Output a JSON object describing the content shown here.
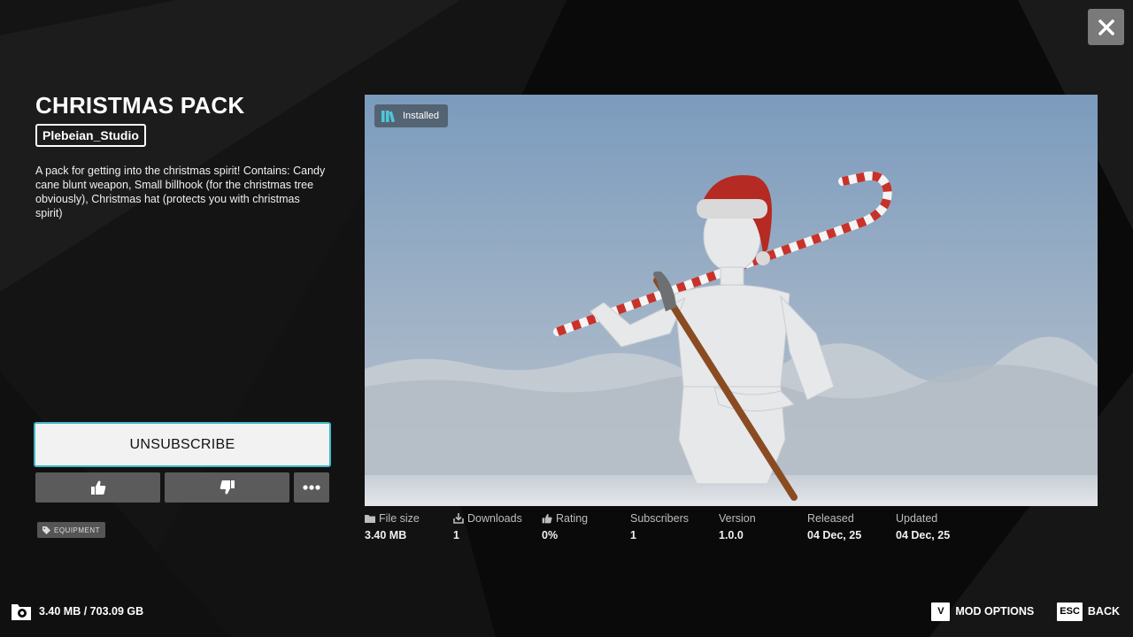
{
  "mod": {
    "title": "CHRISTMAS PACK",
    "author": "Plebeian_Studio",
    "description": "A pack for getting into the christmas spirit! Contains: Candy cane blunt weapon, Small billhook (for the christmas tree obviously), Christmas hat (protects you with christmas spirit)",
    "tag": "EQUIPMENT",
    "status_badge": "Installed"
  },
  "actions": {
    "unsubscribe_label": "UNSUBSCRIBE",
    "thumbs_up_icon": "thumbs-up-icon",
    "thumbs_down_icon": "thumbs-down-icon",
    "more_icon": "more-icon"
  },
  "stats": {
    "file_size": {
      "label": "File size",
      "value": "3.40 MB",
      "icon": "folder-icon"
    },
    "downloads": {
      "label": "Downloads",
      "value": "1",
      "icon": "download-icon"
    },
    "rating": {
      "label": "Rating",
      "value": "0%",
      "icon": "thumbs-up-icon"
    },
    "subscribers": {
      "label": "Subscribers",
      "value": "1"
    },
    "version": {
      "label": "Version",
      "value": "1.0.0"
    },
    "released": {
      "label": "Released",
      "value": "04 Dec, 25"
    },
    "updated": {
      "label": "Updated",
      "value": "04 Dec, 25"
    }
  },
  "footer": {
    "storage": "3.40 MB / 703.09 GB",
    "storage_icon": "storage-settings-icon",
    "mod_options_key": "V",
    "mod_options_label": "MOD OPTIONS",
    "back_key": "ESC",
    "back_label": "BACK"
  },
  "colors": {
    "accent": "#3fb8c8",
    "background": "#0b0b0b",
    "button_gray": "#5b5b5b"
  }
}
